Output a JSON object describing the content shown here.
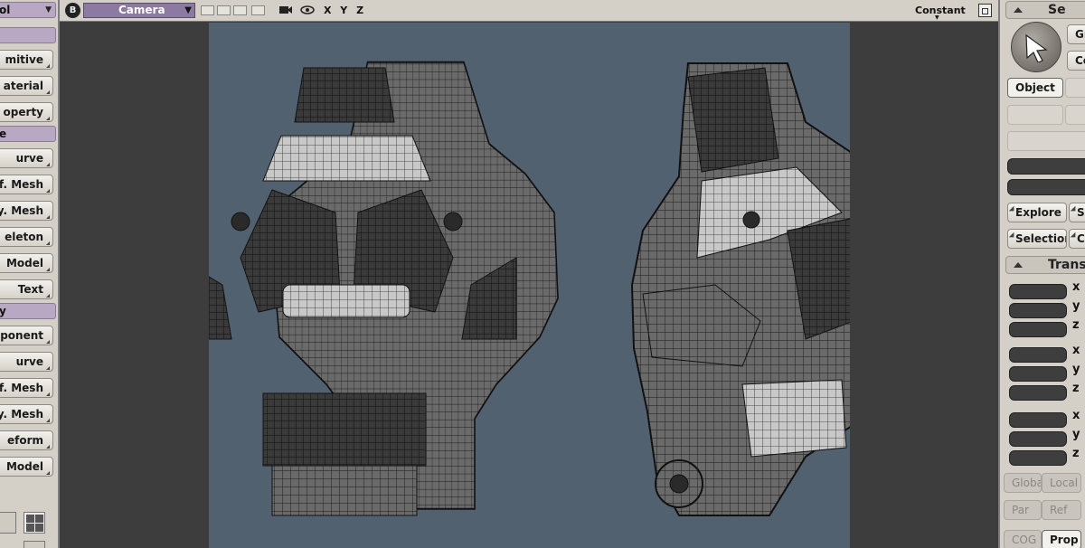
{
  "left_toolbar": {
    "headers": [
      {
        "label": "ol"
      },
      {
        "label": ""
      },
      {
        "label": "e"
      },
      {
        "label": "y"
      }
    ],
    "buttons": [
      "mitive",
      "aterial",
      "operty",
      "urve",
      "f. Mesh",
      "y. Mesh",
      "eleton",
      "Model",
      "Text",
      "ponent",
      "urve",
      "f. Mesh",
      "y. Mesh",
      "eform",
      "Model"
    ]
  },
  "viewport": {
    "view_badge": "B",
    "camera_label": "Camera",
    "axes": "X Y Z",
    "shading_mode": "Constant"
  },
  "right_panel": {
    "section1_title": "Se",
    "group_btn": "Gr",
    "center_btn": "Ce",
    "object_btn": "Object",
    "explore_btn": "Explore",
    "sc_btn": "Sc",
    "selection_btn": "Selection",
    "clus_btn": "Clus",
    "section2_title": "Transf",
    "axis_labels": [
      "x",
      "y",
      "z",
      "x",
      "y",
      "z",
      "x",
      "y",
      "z"
    ],
    "global_btn": "Global",
    "local_btn": "Local",
    "par_btn": "Par",
    "ref_btn": "Ref",
    "cog_btn": "COG",
    "prop_btn": "Prop"
  },
  "colors": {
    "camera_frame": "#526170",
    "viewport_bg": "#3d3d3d",
    "ui_panel": "#d4d0c8",
    "header_purple": "#b9a8c4",
    "camera_select": "#8c7aa3"
  }
}
